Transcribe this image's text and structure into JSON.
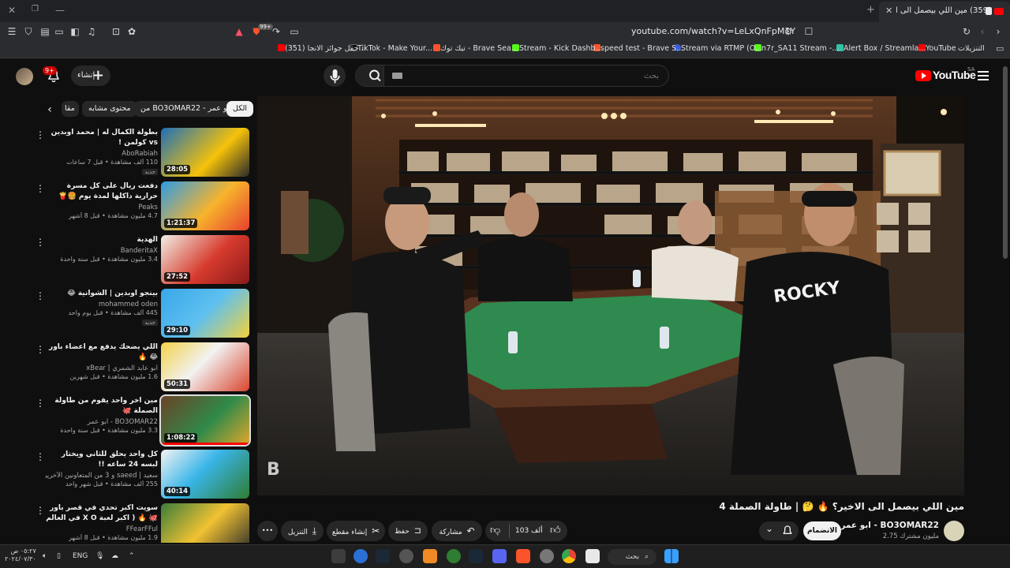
{
  "browser": {
    "tab_title": "(359) مين اللي بيصمل الى الاخ...",
    "url": "youtube.com/watch?v=LeLxQnFpM1Y",
    "shield_count": "99+"
  },
  "bookmarks": [
    {
      "label": "التنزيلات",
      "color": "#aaaaaa"
    },
    {
      "label": "YouTube",
      "color": "#ff0000"
    },
    {
      "label": "Alert Box / Streamla...",
      "color": "#31c3a2"
    },
    {
      "label": "n7r_SA11 Stream -...",
      "color": "#53fc18"
    },
    {
      "label": "Stream via RTMP (O...",
      "color": "#3b5bdb"
    },
    {
      "label": "speed test - Brave S...",
      "color": "#fb542b"
    },
    {
      "label": "Stream - Kick Dashb...",
      "color": "#53fc18"
    },
    {
      "label": "تيك توك - Brave Sea...",
      "color": "#fb542b"
    },
    {
      "label": "TikTok - Make Your...",
      "color": "#111111"
    },
    {
      "label": "(351) حفل جوائز الانجا...",
      "color": "#ff0000"
    }
  ],
  "header": {
    "create_label": "إنشاء",
    "notif_count": "9+",
    "search_placeholder": "بحث",
    "logo_text": "YouTube",
    "logo_region": "SA"
  },
  "chips": [
    "الكل",
    "من BO3OMAR22 - ابو عمر",
    "محتوى مشابه",
    "مقا"
  ],
  "recommendations": [
    {
      "title": "بطولة الكمال له | محمد اوبدين vs كولمن !",
      "channel": "AboRabiah",
      "stats": "110 ألف مشاهدة • قبل 7 ساعات",
      "badge": "جديد",
      "duration": "28:05"
    },
    {
      "title": "دفعت ريال على كل مسرة حرارية داكلها لمدة يوم 🍔🍟",
      "channel": "Peaks",
      "stats": "4.7 مليون مشاهدة • قبل 8 أشهر",
      "badge": "",
      "duration": "1:21:37"
    },
    {
      "title": "الهدية",
      "channel": "BanderitaX",
      "stats": "3.4 مليون مشاهدة • قبل سنة واحدة",
      "badge": "",
      "duration": "27:52"
    },
    {
      "title": "بينجو اوبدين | الشوانية 😂",
      "channel": "mohammed oden",
      "stats": "445 ألف مشاهدة • قبل يوم واحد",
      "badge": "جديد",
      "duration": "29:10"
    },
    {
      "title": "اللي يضحك يدفع مع اعضاء باور 😂 🔥",
      "channel": "ابو عابد الشمري | xBear",
      "stats": "1.6 مليون مشاهدة • قبل شهرين",
      "badge": "",
      "duration": "50:31"
    },
    {
      "title": "مين اخر واحد يقوم من طاولة الصملة 🐙",
      "channel": "BO3OMAR22 - ابو عمر",
      "stats": "3.3 مليون مشاهدة • قبل سنة واحدة",
      "badge": "",
      "duration": "1:08:22"
    },
    {
      "title": "كل واحد يحلق للثاني ويختار لبسه 24 ساعه !!",
      "channel": "سعيد | saeed و 3 من المتعاونين الآخرين",
      "stats": "255 ألف مشاهدة • قبل شهر واحد",
      "badge": "",
      "duration": "40:14"
    },
    {
      "title": "سويت اكبر تحدي في قصر باور 🐙 🔥 ( اكبر لعبة X O في العالم ❌⭕ )",
      "channel": "FFearFFul",
      "stats": "1.9 مليون مشاهدة • قبل 8 أشهر",
      "badge": "",
      "duration": ""
    }
  ],
  "video": {
    "title": "مين اللي بيصمل الى الاخير؟ 🔥 🤔 | طاولة الصملة 4",
    "channel_name": "ابو عمر - BO3OMAR22",
    "subscribers": "2.75 مليون مشترك",
    "join_label": "الانضمام",
    "like_count": "103 ألف",
    "share_label": "مشاركة",
    "save_label": "حفظ",
    "clip_label": "إنشاء مقطع",
    "download_label": "التنزيل",
    "more_label": "•••"
  },
  "taskbar": {
    "search_label": "بحث",
    "lang": "ENG",
    "time": "٠٥:٢٧ ص",
    "date": "٢٠٢٤/٠٧/٣٠"
  }
}
